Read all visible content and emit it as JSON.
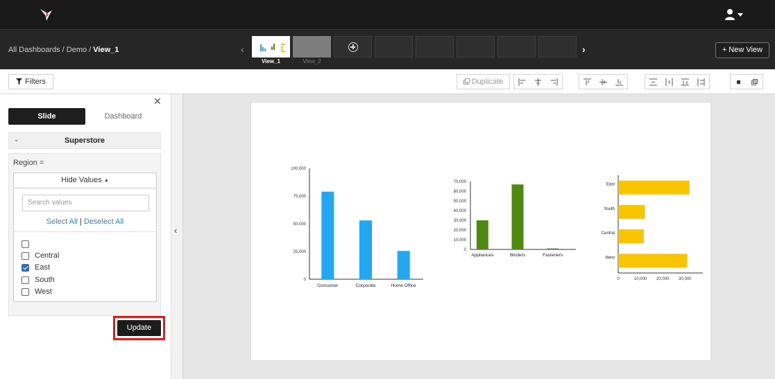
{
  "header": {
    "logo_icon": "hummingbird-logo-icon",
    "user_icon": "user-icon",
    "brand_color": "#1a1a1a"
  },
  "viewbar": {
    "breadcrumb": {
      "root": "All Dashboards",
      "sep1": " / ",
      "parent": "Demo",
      "sep2": " / ",
      "current": "View_1"
    },
    "prev_icon": "chevron-left-icon",
    "next_icon": "chevron-right-icon",
    "views": [
      {
        "label": "View_1",
        "active": true
      },
      {
        "label": "View_2",
        "active": false
      }
    ],
    "add_view_icon": "plus-circle-icon",
    "new_view_label": "+ New View"
  },
  "toolbar": {
    "filters_label": "Filters",
    "duplicate_label": "Duplicate"
  },
  "panel": {
    "close_icon": "close-icon",
    "tabs": [
      "Slide",
      "Dashboard"
    ],
    "datasource": "Superstore",
    "filter_label": "Region =",
    "hide_values_label": "Hide Values",
    "search_placeholder": "Search values",
    "select_all": "Select All",
    "link_sep": "|",
    "deselect_all": "Deselect All",
    "options": [
      {
        "label": "",
        "checked": false
      },
      {
        "label": "Central",
        "checked": false
      },
      {
        "label": "East",
        "checked": true
      },
      {
        "label": "South",
        "checked": false
      },
      {
        "label": "West",
        "checked": false
      }
    ],
    "update_label": "Update",
    "collapse_icon": "chevron-left-icon"
  },
  "chart_data": [
    {
      "type": "bar",
      "categories": [
        "Consumer",
        "Corporate",
        "Home Office"
      ],
      "values": [
        79000,
        53000,
        25500
      ],
      "yticks": [
        "0",
        "25,000",
        "50,000",
        "75,000",
        "100,000"
      ],
      "ylim": [
        0,
        100000
      ],
      "color": "#22a7f0"
    },
    {
      "type": "bar",
      "categories": [
        "Appliances",
        "Binders",
        "Fasteners"
      ],
      "values": [
        30000,
        67000,
        1000
      ],
      "yticks": [
        "0",
        "10,000",
        "20,000",
        "30,000",
        "40,000",
        "50,000",
        "60,000",
        "70,000"
      ],
      "ylim": [
        0,
        70000
      ],
      "color": "#4f8a10"
    },
    {
      "type": "bar",
      "orientation": "horizontal",
      "categories": [
        "East",
        "South",
        "Central",
        "West"
      ],
      "values": [
        32000,
        12000,
        11500,
        31000
      ],
      "xticks": [
        "0",
        "10,000",
        "20,000",
        "30,000"
      ],
      "xlim": [
        0,
        38000
      ],
      "color": "#f9c400"
    }
  ]
}
